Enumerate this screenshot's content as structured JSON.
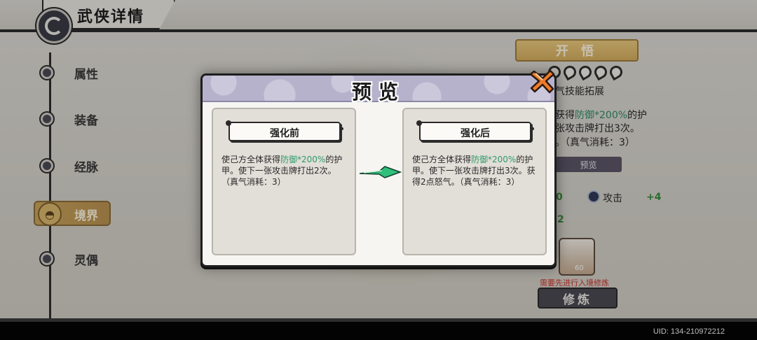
{
  "header": {
    "title": "武侠详情"
  },
  "sidebar": {
    "items": [
      {
        "label": "属性"
      },
      {
        "label": "装备"
      },
      {
        "label": "经脉"
      },
      {
        "label": "境界"
      },
      {
        "label": "灵偶"
      }
    ]
  },
  "right_panel": {
    "kaiwu_label": "开 悟",
    "skill_title": "气技能拓展",
    "desc_line1_a": "获得",
    "desc_line1_hl": "防御*200%",
    "desc_line1_b": "的护",
    "desc_line2": "张攻击牌打出3次。",
    "desc_line3": "。（真气消耗：3）",
    "preview_label": "预览",
    "left_num": "0",
    "attack_label": "攻击",
    "attack_bonus": "+4",
    "left_num2": "2",
    "hero_level": "60",
    "need_text": "需要先进行入境修炼",
    "train_label": "修炼"
  },
  "dialog": {
    "title": "预览",
    "before": {
      "tag": "强化前",
      "desc_a": "使己方全体获得",
      "desc_hl": "防御*200%",
      "desc_b": "的护甲。使下一张攻击牌打出2次。（真气消耗：3）"
    },
    "after": {
      "tag": "强化后",
      "desc_a": "使己方全体获得",
      "desc_hl": "防御*200%",
      "desc_b": "的护甲。使下一张攻击牌打出3次。获得2点怒气。（真气消耗：3）"
    }
  },
  "footer": {
    "uid": "UID: 134-210972212"
  },
  "colors": {
    "accent_gold": "#d4ad5e",
    "highlight_green": "#2f9a6a",
    "close_orange": "#f07a2a"
  }
}
